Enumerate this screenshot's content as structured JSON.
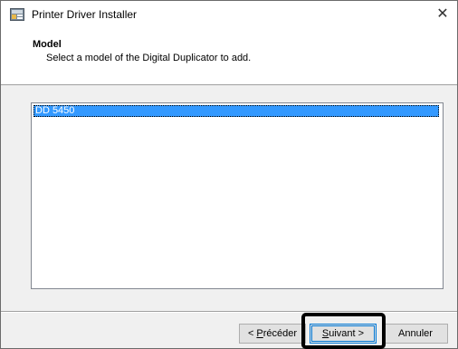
{
  "window": {
    "title": "Printer Driver Installer",
    "icon": "installer-icon",
    "close_glyph": "✕"
  },
  "header": {
    "title": "Model",
    "subtitle": "Select a model of the Digital Duplicator to add."
  },
  "model_list": {
    "items": [
      {
        "label": "DD 5450",
        "selected": true
      }
    ]
  },
  "buttons": {
    "back": {
      "prefix": "< ",
      "mnemonic": "P",
      "rest": "récéder"
    },
    "next": {
      "mnemonic": "S",
      "rest": "uivant >"
    },
    "cancel": "Annuler"
  },
  "colors": {
    "selection": "#3399ff",
    "highlight_box": "#000000",
    "default_button_border": "#0078d7"
  }
}
